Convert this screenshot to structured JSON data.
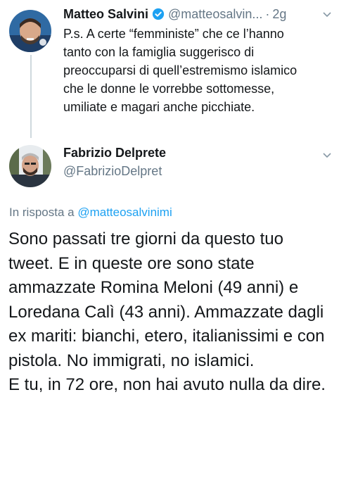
{
  "tweet1": {
    "name": "Matteo Salvini",
    "handle": "@matteosalvin...",
    "separator": "·",
    "time": "2g",
    "text": "P.s. A certe “femministe” che ce l’hanno tanto con la famiglia suggerisco di preoccuparsi di quell’estremismo islamico che le donne le vorrebbe sottomesse, umiliate e magari anche picchiate.",
    "verified_icon": "verified-badge-icon",
    "menu_icon": "chevron-down-icon"
  },
  "tweet2": {
    "name": "Fabrizio Delprete",
    "handle": "@FabrizioDelpret",
    "reply_prefix": "In risposta a ",
    "reply_mention": "@matteosalvinimi",
    "text_para1": "Sono passati tre giorni da questo tuo tweet. E in queste ore sono state ammazzate Romina Meloni (49 anni) e Loredana Calì (43 anni). Ammazzate dagli ex mariti: bianchi, etero, italianissimi e con pistola. No immigrati, no islamici.",
    "text_para2": "E tu, in 72 ore, non hai avuto nulla da dire.",
    "menu_icon": "chevron-down-icon"
  },
  "colors": {
    "text": "#14171a",
    "secondary": "#657786",
    "link": "#1da1f2",
    "thread_line": "#cfd9de"
  }
}
